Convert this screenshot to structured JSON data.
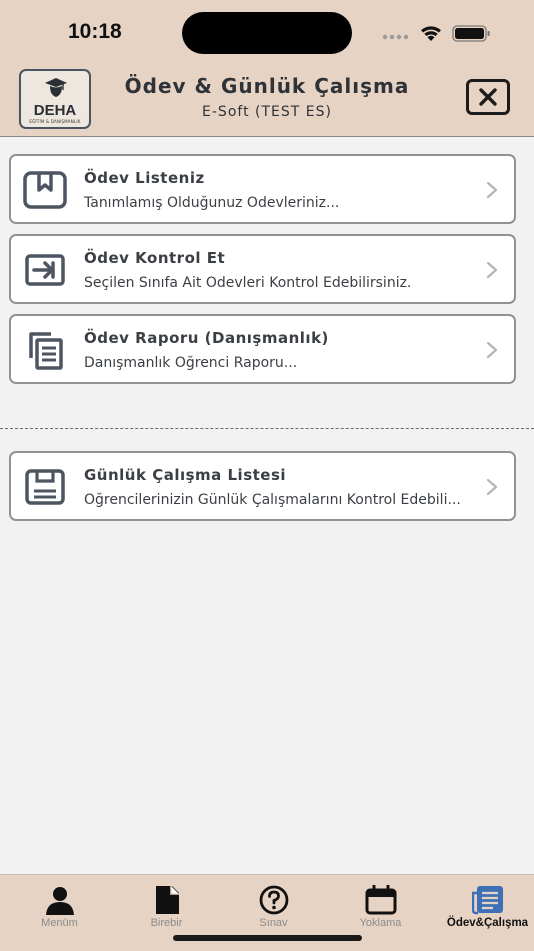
{
  "status_bar": {
    "time": "10:18"
  },
  "header": {
    "logo_text": "DEHA",
    "logo_subtext": "EĞİTİM & DANIŞMANLIK",
    "title": "Ödev & Günlük Çalışma",
    "subtitle": "E-Soft (TEST ES)"
  },
  "menu": [
    {
      "title": "Ödev Listeniz",
      "subtitle": "Tanımlamış Olduğunuz Ödevleriniz...",
      "icon": "bookmark-book-icon"
    },
    {
      "title": "Ödev Kontrol Et",
      "subtitle": "Seçilen Sınıfa Ait Ödevleri Kontrol Edebilirsiniz.",
      "icon": "arrow-in-box-icon"
    },
    {
      "title": "Ödev Raporu (Danışmanlık)",
      "subtitle": "Danışmanlık Öğrenci Raporu...",
      "icon": "copy-documents-icon"
    }
  ],
  "menu2": [
    {
      "title": "Günlük Çalışma Listesi",
      "subtitle": "Öğrencilerinizin Günlük Çalışmalarını Kontrol Edebili...",
      "icon": "notepad-icon"
    }
  ],
  "tabs": [
    {
      "label": "Menüm",
      "icon": "person-icon",
      "active": false
    },
    {
      "label": "Birebir",
      "icon": "document-icon",
      "active": false
    },
    {
      "label": "Sınav",
      "icon": "question-circle-icon",
      "active": false
    },
    {
      "label": "Yoklama",
      "icon": "calendar-icon",
      "active": false
    },
    {
      "label": "Ödev&Çalışma",
      "icon": "newspaper-icon",
      "active": true
    }
  ],
  "colors": {
    "header_bg": "#e6d3c4",
    "page_bg": "#f2f2f2",
    "active_tab_icon": "#3f6fb5",
    "inactive_tab": "#8b8b8b"
  }
}
